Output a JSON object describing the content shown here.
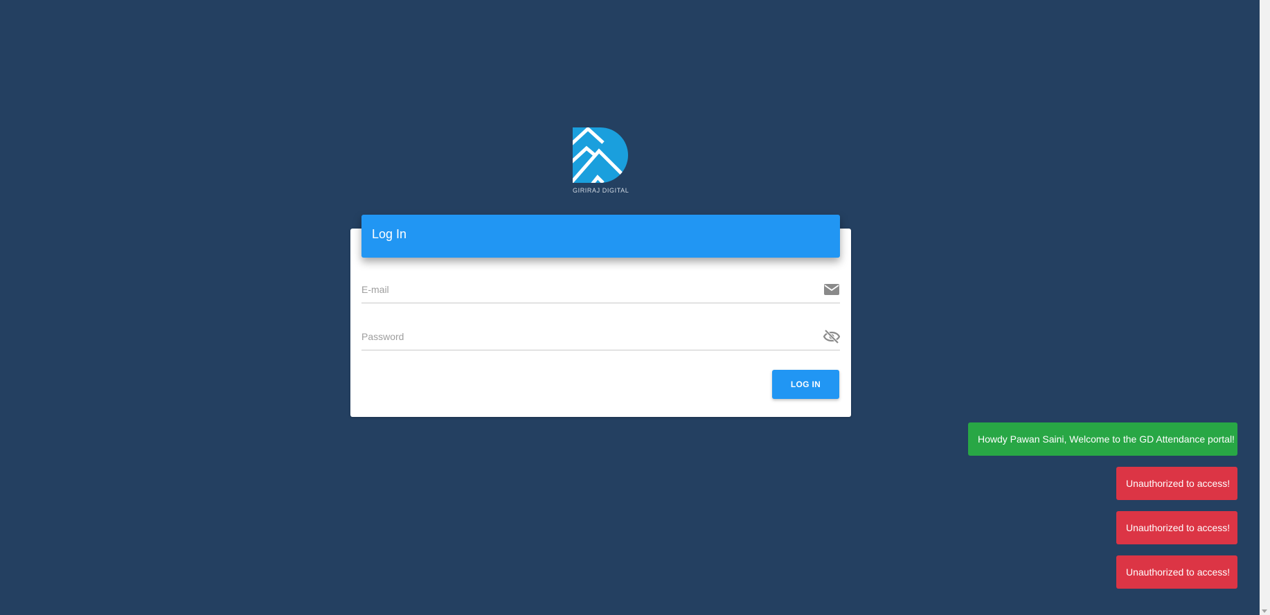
{
  "brand": {
    "logo_text": "GIRIRAJ DIGITAL",
    "logo_color": "#1a9fdd"
  },
  "login_card": {
    "title": "Log In",
    "email": {
      "placeholder": "E-mail",
      "value": "",
      "icon": "envelope-icon"
    },
    "password": {
      "placeholder": "Password",
      "value": "",
      "icon": "eye-off-icon"
    },
    "submit_label": "LOG IN"
  },
  "toasts": [
    {
      "type": "success",
      "message": "Howdy Pawan Saini, Welcome to the GD Attendance portal!"
    },
    {
      "type": "error",
      "message": "Unauthorized to access!"
    },
    {
      "type": "error",
      "message": "Unauthorized to access!"
    },
    {
      "type": "error",
      "message": "Unauthorized to access!"
    }
  ],
  "colors": {
    "page_background": "#244061",
    "primary": "#2196f3",
    "success": "#28a745",
    "error": "#dc3545"
  }
}
